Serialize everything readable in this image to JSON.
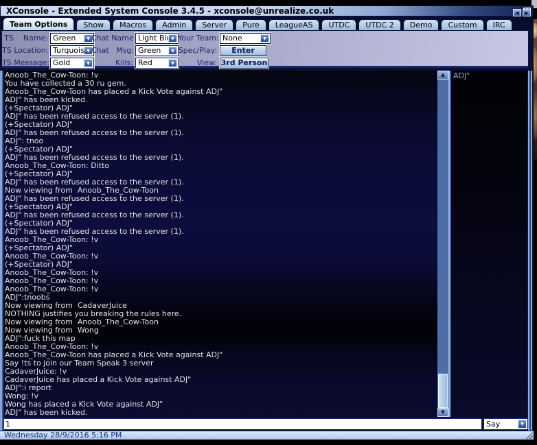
{
  "window": {
    "title": "XConsole - Extended System Console 3.4.5 - xconsole@unrealize.co.uk",
    "close_glyph": "✕"
  },
  "tabs": [
    {
      "label": "Team Options",
      "active": true
    },
    {
      "label": "Show"
    },
    {
      "label": "Macros"
    },
    {
      "label": "Admin"
    },
    {
      "label": "Server"
    },
    {
      "label": "Pure"
    },
    {
      "label": "LeagueAS"
    },
    {
      "label": "UTDC"
    },
    {
      "label": "UTDC 2"
    },
    {
      "label": "Demo"
    },
    {
      "label": "Custom"
    },
    {
      "label": "IRC"
    }
  ],
  "tab_scroll": {
    "left_glyph": "◀",
    "right_glyph": "▶"
  },
  "options": {
    "ts_name": {
      "label": "TS    Name:",
      "value": "Green"
    },
    "ts_location": {
      "label": "TS Location:",
      "value": "Turquoise"
    },
    "ts_message": {
      "label": "TS Message:",
      "value": "Gold"
    },
    "chat_name": {
      "label": "Chat Name:",
      "value": "Light Blue"
    },
    "chat_msg": {
      "label": "Chat   Msg:",
      "value": "Green"
    },
    "kills": {
      "label": "Kills:",
      "value": "Red"
    },
    "your_team": {
      "label": "Your Team:",
      "value": "None"
    },
    "spec_play": {
      "label": "Spec/Play:",
      "button": "Enter Game"
    },
    "view": {
      "label": "View:",
      "button": "3rd Person"
    }
  },
  "console": {
    "lines": [
      "Anoob_The_Cow-Toon: !v",
      "You have collected a 30 ru gem.",
      "Anoob_The_Cow-Toon has placed a Kick Vote against ADJ\"",
      "ADJ\" has been kicked.",
      "(+Spectator) ADJ\"",
      "ADJ\" has been refused access to the server (1).",
      "(+Spectator) ADJ\"",
      "ADJ\" has been refused access to the server (1).",
      "ADJ\": tnoo",
      "(+Spectator) ADJ\"",
      "ADJ\" has been refused access to the server (1).",
      "Anoob_The_Cow-Toon: Ditto",
      "(+Spectator) ADJ\"",
      "ADJ\" has been refused access to the server (1).",
      "Now viewing from  Anoob_The_Cow-Toon",
      "ADJ\" has been refused access to the server (1).",
      "(+Spectator) ADJ\"",
      "ADJ\" has been refused access to the server (1).",
      "(+Spectator) ADJ\"",
      "ADJ\" has been refused access to the server (1).",
      "Anoob_The_Cow-Toon: !v",
      "(+Spectator) ADJ\"",
      "Anoob_The_Cow-Toon: !v",
      "(+Spectator) ADJ\"",
      "Anoob_The_Cow-Toon: !v",
      "Anoob_The_Cow-Toon: !v",
      "Anoob_The_Cow-Toon: !v",
      "ADJ\":tnoobs",
      "Now viewing from  CadaverJuice",
      "NOTHING justifies you breaking the rules here.",
      "Now viewing from  Anoob_The_Cow-Toon",
      "Now viewing from  Wong",
      "ADJ\":fuck this map",
      "Anoob_The_Cow-Toon: !v",
      "Anoob_The_Cow-Toon has placed a Kick Vote against ADJ\"",
      "Say !ts to join our Team Speak 3 server",
      "CadaverJuice: !v",
      "CadaverJuice has placed a Kick Vote against ADJ\"",
      "ADJ\":i report",
      "Wong: !v",
      "Wong has placed a Kick Vote against ADJ\"",
      "ADJ\" has been kicked."
    ]
  },
  "player_panel": {
    "entries": [
      "ADJ\""
    ]
  },
  "input": {
    "value": "1",
    "mode": "Say"
  },
  "status_bar": {
    "datetime": "Wednesday 28/9/2016 5:16 PM"
  },
  "glyphs": {
    "down_arrow": "▼",
    "up_arrow": "▲"
  },
  "colors": {
    "titlebar_left": "#cddcf3",
    "titlebar_right": "#131f52",
    "panel": "#b7b9da",
    "console_bg": "#0c0c3a",
    "console_text": "#e4e4e4",
    "statusbar": "#bcd4f0"
  }
}
